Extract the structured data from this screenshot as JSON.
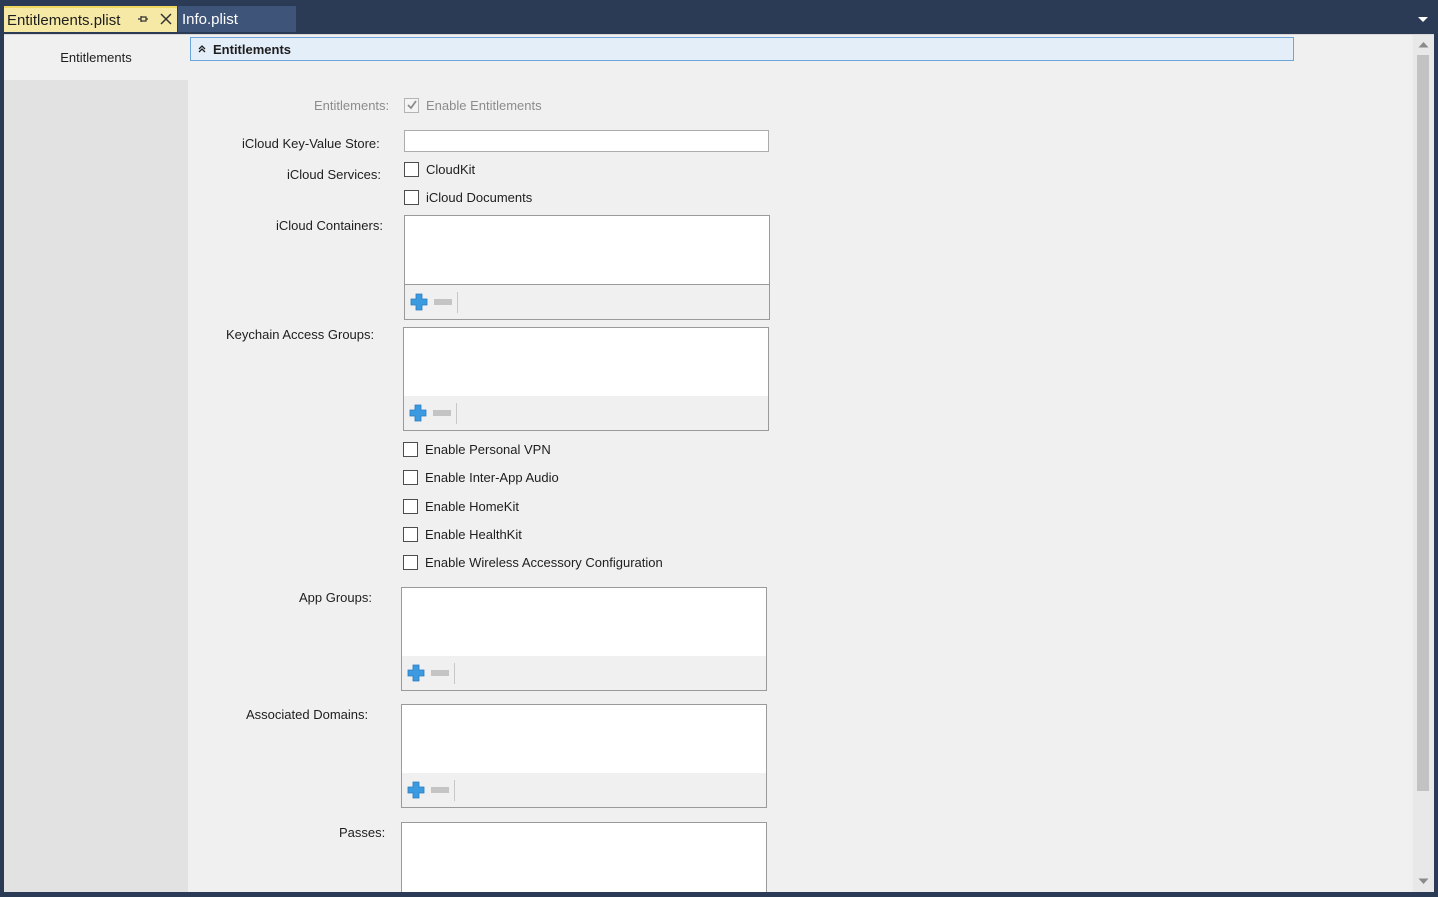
{
  "tabs": [
    {
      "label": "Entitlements.plist",
      "active": true
    },
    {
      "label": "Info.plist",
      "active": false
    }
  ],
  "sidebar": {
    "items": [
      {
        "label": "Entitlements",
        "selected": true
      }
    ]
  },
  "section": {
    "title": "Entitlements",
    "icon": "collapse-up-icon"
  },
  "form": {
    "entitlements_label": "Entitlements:",
    "enable_entitlements": {
      "label": "Enable Entitlements",
      "checked": true,
      "disabled": true
    },
    "icloud_kv_label": "iCloud Key-Value Store:",
    "icloud_kv_value": "",
    "icloud_services_label": "iCloud Services:",
    "cloudkit": {
      "label": "CloudKit",
      "checked": false
    },
    "icloud_documents": {
      "label": "iCloud Documents",
      "checked": false
    },
    "icloud_containers_label": "iCloud Containers:",
    "keychain_label": "Keychain Access Groups:",
    "personal_vpn": {
      "label": "Enable Personal VPN",
      "checked": false
    },
    "inter_app_audio": {
      "label": "Enable Inter-App Audio",
      "checked": false
    },
    "homekit": {
      "label": "Enable HomeKit",
      "checked": false
    },
    "healthkit": {
      "label": "Enable HealthKit",
      "checked": false
    },
    "wireless_accessory": {
      "label": "Enable Wireless Accessory Configuration",
      "checked": false
    },
    "app_groups_label": "App Groups:",
    "associated_domains_label": "Associated Domains:",
    "passes_label": "Passes:"
  },
  "colors": {
    "tab_active_bg": "#f5e9a5",
    "tab_inactive_bg": "#3e5478",
    "chrome_bg": "#2b3a55",
    "header_border": "#6aa6dc",
    "add_icon_color": "#3c9be0"
  }
}
